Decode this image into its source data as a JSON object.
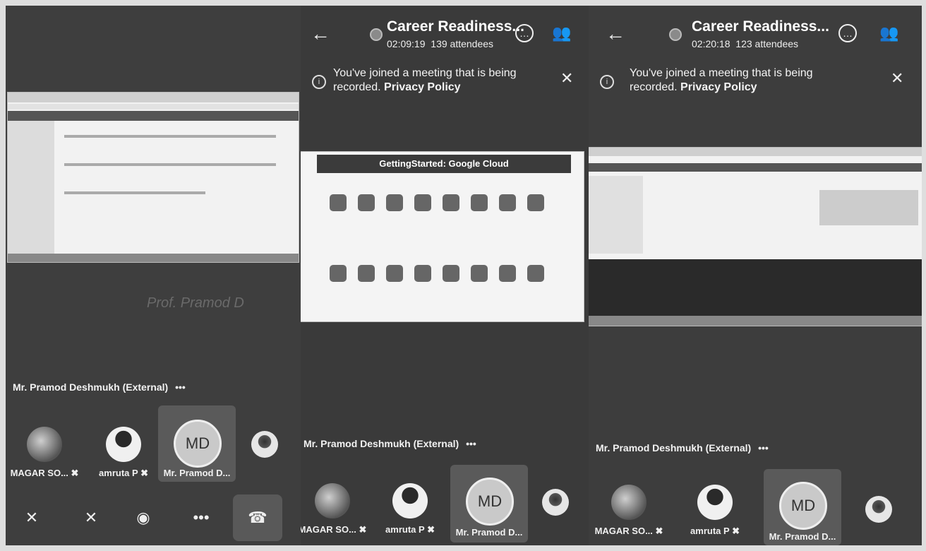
{
  "panels": [
    {
      "presenter": "Mr. Pramod Deshmukh (External)",
      "more": "•••",
      "watermark": "Prof. Pramod D",
      "participants": [
        {
          "name": "MAGAR SO...",
          "muted_icon": "✖"
        },
        {
          "name": "amruta P",
          "muted_icon": "✖"
        },
        {
          "name": "Mr. Pramod D...",
          "initials": "MD"
        }
      ],
      "controls": {
        "camera": "✕",
        "mic": "✕",
        "audio": "◉",
        "more": "•••",
        "hangup": "☎"
      }
    },
    {
      "back": "←",
      "title": "Career Readiness...",
      "time": "02:09:19",
      "attendees": "139 attendees",
      "notice_line1": "You've joined a meeting that is being",
      "notice_line2a": "recorded. ",
      "notice_line2b": "Privacy Policy",
      "close": "✕",
      "slide_title": "GettingStarted: Google Cloud",
      "presenter": "Mr. Pramod Deshmukh (External)",
      "more": "•••",
      "participants": [
        {
          "name": "MAGAR SO...",
          "muted_icon": "✖"
        },
        {
          "name": "amruta P",
          "muted_icon": "✖"
        },
        {
          "name": "Mr. Pramod D...",
          "initials": "MD"
        }
      ]
    },
    {
      "back": "←",
      "title": "Career Readiness...",
      "time": "02:20:18",
      "attendees": "123 attendees",
      "notice_line1": "You've joined a meeting that is being",
      "notice_line2a": "recorded. ",
      "notice_line2b": "Privacy Policy",
      "close": "✕",
      "presenter": "Mr. Pramod Deshmukh (External)",
      "more": "•••",
      "participants": [
        {
          "name": "MAGAR SO...",
          "muted_icon": "✖"
        },
        {
          "name": "amruta P",
          "muted_icon": "✖"
        },
        {
          "name": "Mr. Pramod D...",
          "initials": "MD"
        }
      ]
    }
  ],
  "colors": {
    "hangup": "#595959",
    "panel": "#3c3c3c"
  }
}
